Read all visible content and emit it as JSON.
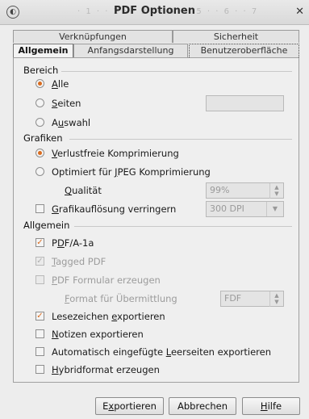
{
  "window": {
    "title": "PDF Optionen",
    "ruler_text": "· 1 · · 2 · · 3 · · 4 · · 5 · · 6 · · 7",
    "close_glyph": "✕",
    "icon_glyph": "◐"
  },
  "tabs": {
    "row1": [
      "Verknüpfungen",
      "Sicherheit"
    ],
    "row2": [
      "Allgemein",
      "Anfangsdarstellung",
      "Benutzeroberfläche"
    ],
    "active": "Allgemein"
  },
  "bereich": {
    "heading": "Bereich",
    "alle": {
      "prefix": "",
      "u": "A",
      "rest": "lle",
      "selected": true
    },
    "seiten": {
      "prefix": "",
      "u": "S",
      "rest": "eiten",
      "selected": false,
      "value": ""
    },
    "auswahl": {
      "prefix": "A",
      "u": "u",
      "rest": "swahl",
      "selected": false
    }
  },
  "grafiken": {
    "heading": "Grafiken",
    "verlustfrei": {
      "prefix": "",
      "u": "V",
      "rest": "erlustfreie Komprimierung",
      "selected": true
    },
    "jpeg": {
      "prefix": "Optimiert für ",
      "u": "J",
      "rest": "PEG Komprimierung",
      "selected": false
    },
    "qualitaet": {
      "prefix": "",
      "u": "Q",
      "rest": "ualität",
      "value": "99%"
    },
    "aufloesung": {
      "prefix": "",
      "u": "G",
      "rest": "rafikauflösung verringern",
      "checked": false,
      "value": "300 DPI"
    }
  },
  "allgemein": {
    "heading": "Allgemein",
    "pdfa": {
      "prefix": "P",
      "u": "D",
      "rest": "F/A-1a",
      "checked": true,
      "disabled": false
    },
    "tagged": {
      "prefix": "",
      "u": "T",
      "rest": "agged PDF",
      "checked": true,
      "disabled": true
    },
    "formular": {
      "prefix": "",
      "u": "P",
      "rest": "DF Formular erzeugen",
      "checked": false,
      "disabled": true
    },
    "format": {
      "prefix": "",
      "u": "F",
      "rest": "ormat für Übermittlung",
      "value": "FDF"
    },
    "lesezeichen": {
      "prefix": "Lesezeichen ",
      "u": "e",
      "rest": "xportieren",
      "checked": true,
      "disabled": false
    },
    "notizen": {
      "prefix": "",
      "u": "N",
      "rest": "otizen exportieren",
      "checked": false,
      "disabled": false
    },
    "leerseiten": {
      "prefix": "Automatisch eingefügte ",
      "u": "L",
      "rest": "eerseiten exportieren",
      "checked": false,
      "disabled": false
    },
    "hybrid": {
      "prefix": "",
      "u": "H",
      "rest": "ybridformat erzeugen",
      "checked": false,
      "disabled": false
    }
  },
  "buttons": {
    "exportieren": {
      "prefix": "E",
      "u": "x",
      "rest": "portieren"
    },
    "abbrechen": {
      "prefix": "Abbrechen",
      "u": "",
      "rest": ""
    },
    "hilfe": {
      "prefix": "",
      "u": "H",
      "rest": "ilfe"
    }
  },
  "colors": {
    "accent": "#d96b1e"
  }
}
